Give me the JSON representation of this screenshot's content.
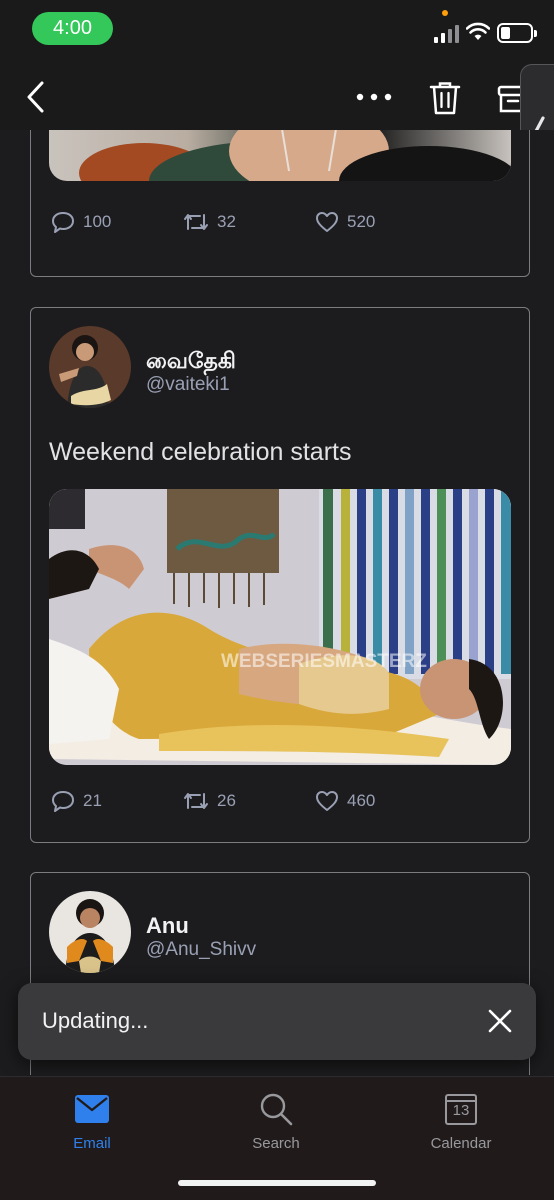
{
  "status_bar": {
    "time": "4:00"
  },
  "toast": {
    "text": "Updating..."
  },
  "tweets": [
    {
      "replies": "100",
      "retweets": "32",
      "likes": "520"
    },
    {
      "name": "வைதேகி",
      "handle": "@vaiteki1",
      "text": "Weekend celebration starts",
      "watermark": "WEBSERIESMASTERZ",
      "replies": "21",
      "retweets": "26",
      "likes": "460"
    },
    {
      "name": "Anu",
      "handle": "@Anu_Shivv"
    }
  ],
  "tabs": [
    {
      "label": "Email",
      "icon": "envelope-icon",
      "active": true
    },
    {
      "label": "Search",
      "icon": "magnifier-icon",
      "active": false
    },
    {
      "label": "Calendar",
      "icon": "calendar-icon",
      "day": "13",
      "active": false
    }
  ],
  "colors": {
    "accent": "#2f80ed",
    "status_pill": "#34c759",
    "card_border": "#7c7c80"
  }
}
